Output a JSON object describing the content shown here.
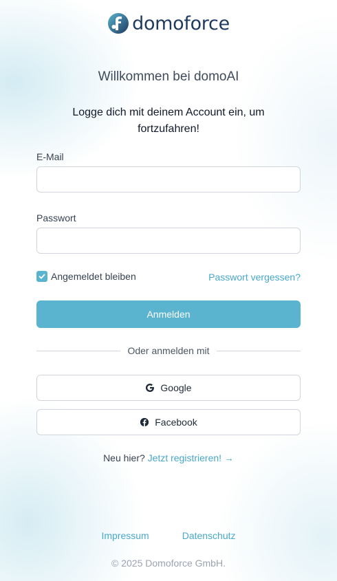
{
  "brand": {
    "name": "domoforce",
    "logo_icon": "domoforce-logo-icon",
    "accent_color": "#5ab4d0",
    "link_color": "#49a8c9"
  },
  "header": {
    "title": "Willkommen bei domoAI",
    "subtitle": "Logge dich mit deinem Account ein, um fortzufahren!"
  },
  "form": {
    "email_label": "E-Mail",
    "email_value": "",
    "password_label": "Passwort",
    "password_value": "",
    "remember_label": "Angemeldet bleiben",
    "remember_checked": true,
    "forgot_label": "Passwort vergessen?",
    "submit_label": "Anmelden"
  },
  "divider_text": "Oder anmelden mit",
  "social": [
    {
      "label": "Google",
      "icon": "google-icon"
    },
    {
      "label": "Facebook",
      "icon": "facebook-icon"
    }
  ],
  "register": {
    "prompt": "Neu hier?",
    "link_label": "Jetzt registrieren! →"
  },
  "footer": {
    "links": [
      "Impressum",
      "Datenschutz"
    ],
    "copyright": "© 2025 Domoforce GmbH."
  }
}
